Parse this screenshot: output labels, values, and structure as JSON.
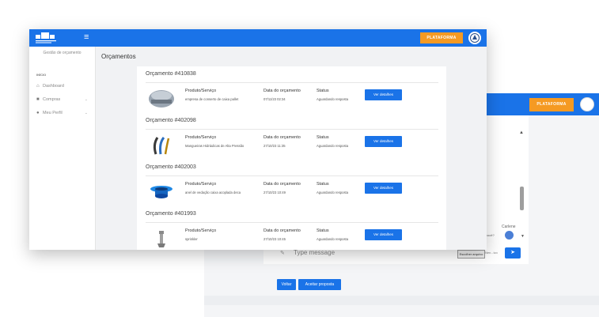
{
  "colors": {
    "primary": "#1a73e8",
    "accent": "#f59a23"
  },
  "back_window": {
    "platform_button": "PLATAFORMA",
    "chat": {
      "user_name": "Carlene",
      "partial_text": "você?",
      "message_placeholder": "Type message",
      "file_button": "Escolher arquivo",
      "file_status": "Nen...ivo",
      "send_icon": "send-icon"
    },
    "buttons": {
      "back": "Voltar",
      "accept": "Aceitar proposta"
    }
  },
  "front_window": {
    "logo_text": "SOLUÇÕES",
    "sidebar": {
      "title": "Gestão de orçamento",
      "section": "INÍCIO",
      "items": [
        {
          "label": "Dashboard",
          "icon": "home-icon"
        },
        {
          "label": "Compras",
          "icon": "bag-icon",
          "chevron": "⌄"
        },
        {
          "label": "Meu Perfil",
          "icon": "user-icon",
          "chevron": "⌄"
        }
      ]
    },
    "topbar": {
      "platform_button": "PLATAFORMA"
    },
    "page_title": "Orçamentos",
    "column_labels": {
      "product": "Produto/Serviço",
      "date": "Data do orçamento",
      "status": "Status"
    },
    "quotes": [
      {
        "title": "Orçamento #410838",
        "product": "empresa de conserto de caixa pallet",
        "date": "07/11/23 02:34",
        "status": "Aguardando resposta",
        "button": "Ver detalhes"
      },
      {
        "title": "Orçamento #402098",
        "product": "Mangueiras Hidráulicas de Alta Pressão",
        "date": "27/10/23 11:35",
        "status": "Aguardando resposta",
        "button": "Ver detalhes"
      },
      {
        "title": "Orçamento #402003",
        "product": "anel de vedação caixa acoplada deca",
        "date": "27/10/23 10:49",
        "status": "Aguardando resposta",
        "button": "Ver detalhes"
      },
      {
        "title": "Orçamento #401993",
        "product": "sprinkler",
        "date": "27/10/23 10:45",
        "status": "Aguardando resposta",
        "button": "Ver detalhes"
      }
    ]
  }
}
